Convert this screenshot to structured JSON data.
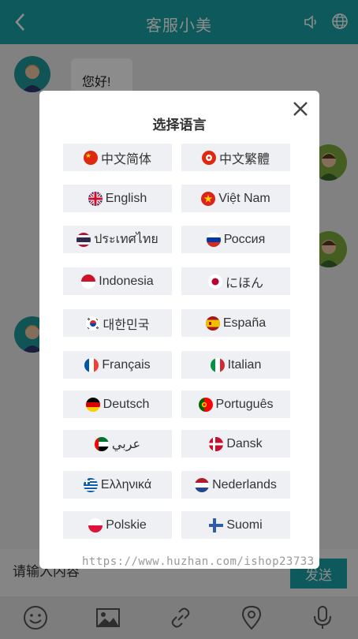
{
  "header": {
    "title": "客服小美",
    "back_icon": "chevron-left-icon",
    "speaker_icon": "speaker-icon",
    "language_icon": "globe-icon",
    "color": "#1aa3a6"
  },
  "chat": {
    "messages": [
      {
        "from": "agent",
        "text": "您好!"
      }
    ]
  },
  "input": {
    "placeholder": "请输入内容",
    "send_label": "发送"
  },
  "toolbar": {
    "icons": [
      "emoji-icon",
      "image-icon",
      "link-icon",
      "location-icon",
      "microphone-icon"
    ]
  },
  "language_modal": {
    "title": "选择语言",
    "close_icon": "close-icon",
    "languages": [
      {
        "label": "中文简体",
        "flag": "china-flag-icon"
      },
      {
        "label": "中文繁體",
        "flag": "hongkong-flag-icon"
      },
      {
        "label": "English",
        "flag": "uk-flag-icon"
      },
      {
        "label": "Việt Nam",
        "flag": "vietnam-flag-icon"
      },
      {
        "label": "ประเทศไทย",
        "flag": "thailand-flag-icon"
      },
      {
        "label": "Россия",
        "flag": "russia-flag-icon"
      },
      {
        "label": "Indonesia",
        "flag": "indonesia-flag-icon"
      },
      {
        "label": "にほん",
        "flag": "japan-flag-icon"
      },
      {
        "label": "대한민국",
        "flag": "korea-flag-icon"
      },
      {
        "label": "España",
        "flag": "spain-flag-icon"
      },
      {
        "label": "Français",
        "flag": "france-flag-icon"
      },
      {
        "label": "Italian",
        "flag": "italy-flag-icon"
      },
      {
        "label": "Deutsch",
        "flag": "germany-flag-icon"
      },
      {
        "label": "Português",
        "flag": "portugal-flag-icon"
      },
      {
        "label": "عربي",
        "flag": "uae-flag-icon"
      },
      {
        "label": "Dansk",
        "flag": "denmark-flag-icon"
      },
      {
        "label": "Ελληνικά",
        "flag": "greece-flag-icon"
      },
      {
        "label": "Nederlands",
        "flag": "netherlands-flag-icon"
      },
      {
        "label": "Polskie",
        "flag": "poland-flag-icon"
      },
      {
        "label": "Suomi",
        "flag": "finland-flag-icon"
      }
    ]
  },
  "watermark": "https://www.huzhan.com/ishop23733"
}
